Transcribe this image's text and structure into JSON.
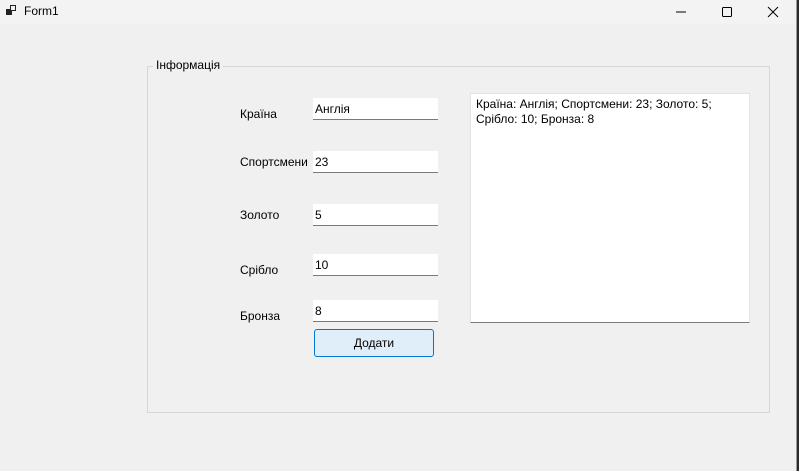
{
  "window": {
    "title": "Form1"
  },
  "group": {
    "title": "Інформація"
  },
  "form": {
    "country_label": "Країна",
    "country_value": "Англія",
    "athletes_label": "Спортсмени",
    "athletes_value": "23",
    "gold_label": "Золото",
    "gold_value": "5",
    "silver_label": "Срібло",
    "silver_value": "10",
    "bronze_label": "Бронза",
    "bronze_value": "8",
    "add_button_label": "Додати"
  },
  "output": {
    "text": "Країна: Англія; Спортсмени: 23; Золото: 5; Срібло: 10; Бронза: 8"
  },
  "icons": {
    "app": "app-icon",
    "minimize": "minimize-icon",
    "maximize": "maximize-icon",
    "close": "close-icon"
  }
}
